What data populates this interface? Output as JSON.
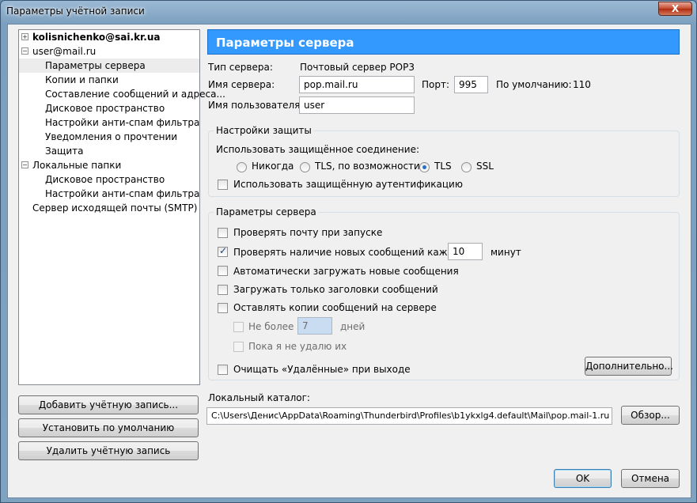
{
  "window": {
    "title": "Параметры учётной записи",
    "close_glyph": "X"
  },
  "tree": {
    "items": [
      {
        "expander": "+",
        "text": "kolisnichenko@sai.kr.ua",
        "bold": true
      },
      {
        "expander": "−",
        "text": "user@mail.ru"
      },
      {
        "text": "Параметры сервера",
        "selected": true
      },
      {
        "text": "Копии и папки"
      },
      {
        "text": "Составление сообщений и адреса..."
      },
      {
        "text": "Дисковое пространство"
      },
      {
        "text": "Настройки анти-спам фильтра"
      },
      {
        "text": "Уведомления о прочтении"
      },
      {
        "text": "Защита"
      },
      {
        "expander": "−",
        "text": "Локальные папки"
      },
      {
        "text": "Дисковое пространство"
      },
      {
        "text": "Настройки анти-спам фильтра"
      },
      {
        "text": "Сервер исходящей почты (SMTP)"
      }
    ]
  },
  "left_buttons": {
    "add": "Добавить учётную запись...",
    "default": "Установить по умолчанию",
    "delete": "Удалить учётную запись"
  },
  "panel": {
    "header": "Параметры сервера",
    "server_type_label": "Тип сервера:",
    "server_type_value": "Почтовый сервер POP3",
    "server_name_label": "Имя сервера:",
    "server_name_value": "pop.mail.ru",
    "port_label": "Порт:",
    "port_value": "995",
    "default_label": "По умолчанию:",
    "default_value": "110",
    "username_label": "Имя пользователя:",
    "username_value": "user"
  },
  "security": {
    "legend": "Настройки защиты",
    "secure_conn_label": "Использовать защищённое соединение:",
    "radios": [
      {
        "label": "Никогда",
        "checked": false
      },
      {
        "label": "TLS, по возможности",
        "checked": false
      },
      {
        "label": "TLS",
        "checked": true
      },
      {
        "label": "SSL",
        "checked": false
      }
    ],
    "secure_auth_label": "Использовать защищённую аутентификацию",
    "secure_auth_checked": false
  },
  "server_settings": {
    "legend": "Параметры сервера",
    "check_on_start": "Проверять почту при запуске",
    "check_every": "Проверять наличие новых сообщений каждые",
    "check_every_value": "10",
    "minutes": "минут",
    "auto_download": "Автоматически загружать новые сообщения",
    "headers_only": "Загружать только заголовки сообщений",
    "leave_copies": "Оставлять копии сообщений на сервере",
    "not_more": "Не более",
    "not_more_value": "7",
    "days": "дней",
    "until_delete": "Пока я не удалю их",
    "empty_trash": "Очищать «Удалённые» при выходе",
    "advanced_button": "Дополнительно..."
  },
  "local_dir": {
    "label": "Локальный каталог:",
    "path": "C:\\Users\\Денис\\AppData\\Roaming\\Thunderbird\\Profiles\\b1ykxlg4.default\\Mail\\pop.mail-1.ru",
    "browse_button": "Обзор..."
  },
  "dialog_buttons": {
    "ok": "OK",
    "cancel": "Отмена"
  }
}
